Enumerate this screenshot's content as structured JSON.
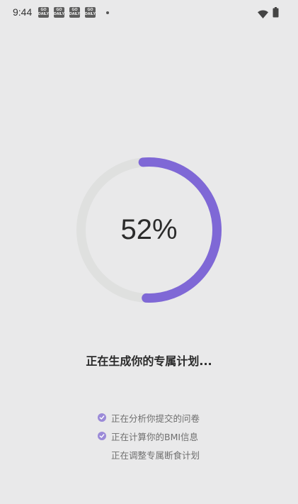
{
  "status_bar": {
    "time": "9:44",
    "notification_icons": [
      {
        "icon": "go-app-icon",
        "text": "GO\nDAILY"
      },
      {
        "icon": "go-app-icon",
        "text": "GO\nDAILY"
      },
      {
        "icon": "go-app-icon",
        "text": "GO\nDAILY"
      },
      {
        "icon": "go-app-icon",
        "text": "GO\nDAILY"
      }
    ],
    "wifi_icon": "wifi-icon",
    "battery_icon": "battery-icon"
  },
  "progress": {
    "value": 0.52,
    "label": "52%",
    "track_color": "#dfe0df",
    "fill_color": "#7f68d6"
  },
  "main_status": "正在生成你的专属计划...",
  "steps": [
    {
      "label": "正在分析你提交的问卷",
      "done": true
    },
    {
      "label": "正在计算你的BMI信息",
      "done": true
    },
    {
      "label": "正在调整专属断食计划",
      "done": false
    }
  ],
  "accent_color": "#9b8ad8"
}
